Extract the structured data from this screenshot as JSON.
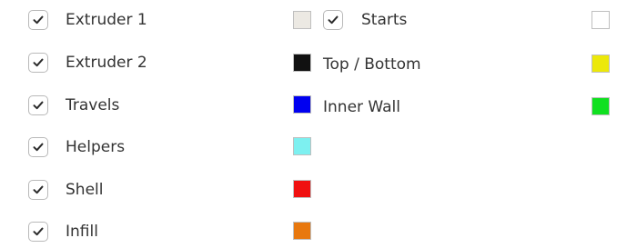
{
  "left_column": [
    {
      "label": "Extruder 1",
      "checked": true,
      "color": "#ece9e3"
    },
    {
      "label": "Extruder 2",
      "checked": true,
      "color": "#111111"
    },
    {
      "label": "Travels",
      "checked": true,
      "color": "#0000f0"
    },
    {
      "label": "Helpers",
      "checked": true,
      "color": "#7df0f0"
    },
    {
      "label": "Shell",
      "checked": true,
      "color": "#f01010"
    },
    {
      "label": "Infill",
      "checked": true,
      "color": "#e8780e"
    }
  ],
  "right_column": [
    {
      "label": "Starts",
      "checkbox": true,
      "checked": true,
      "color": "#ffffff"
    },
    {
      "label": "Top / Bottom",
      "checkbox": false,
      "color": "#ece80a"
    },
    {
      "label": "Inner Wall",
      "checkbox": false,
      "color": "#10e020"
    }
  ],
  "icons": {
    "check": "checkmark-icon"
  }
}
